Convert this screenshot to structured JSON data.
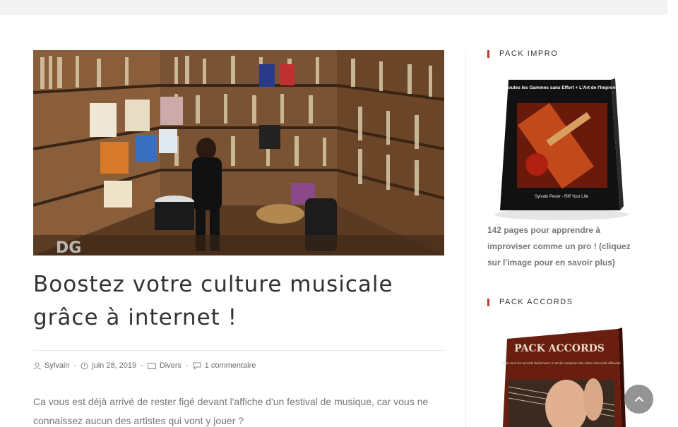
{
  "post": {
    "title": "Boostez votre culture musicale grâce à internet !",
    "image_watermark": "DG",
    "meta": {
      "author": "Sylvain",
      "date": "juin 28, 2019",
      "category": "Divers",
      "comments": "1 commentaire",
      "separator": "-"
    },
    "excerpt": "Ca vous est déjà arrivé de rester figé devant l'affiche d'un festival de musique, car vous ne connaissez aucun des artistes qui vont y jouer ?"
  },
  "sidebar": {
    "widget1": {
      "title": "PACK IMPRO",
      "cover_title": "Jouer toutes les Gammes sans Effort + L'Art de l'Improvisation",
      "cover_author": "Sylvain Pecer - Riff Your Life",
      "description": "142 pages pour apprendre à improviser comme un pro ! (cliquez sur l'image pour en savoir plus)"
    },
    "widget2": {
      "title": "PACK ACCORDS",
      "cover_title": "PACK ACCORDS",
      "cover_subtitle": "Jouez tous les accords facilement + L'art de composer des suites d'accords efficaces"
    }
  },
  "colors": {
    "accent": "#c0392b",
    "topbar": "#f3f3f3",
    "scroll_button": "#949494"
  },
  "icons": [
    "user-icon",
    "clock-icon",
    "folder-icon",
    "comment-icon",
    "chevron-up-icon"
  ]
}
